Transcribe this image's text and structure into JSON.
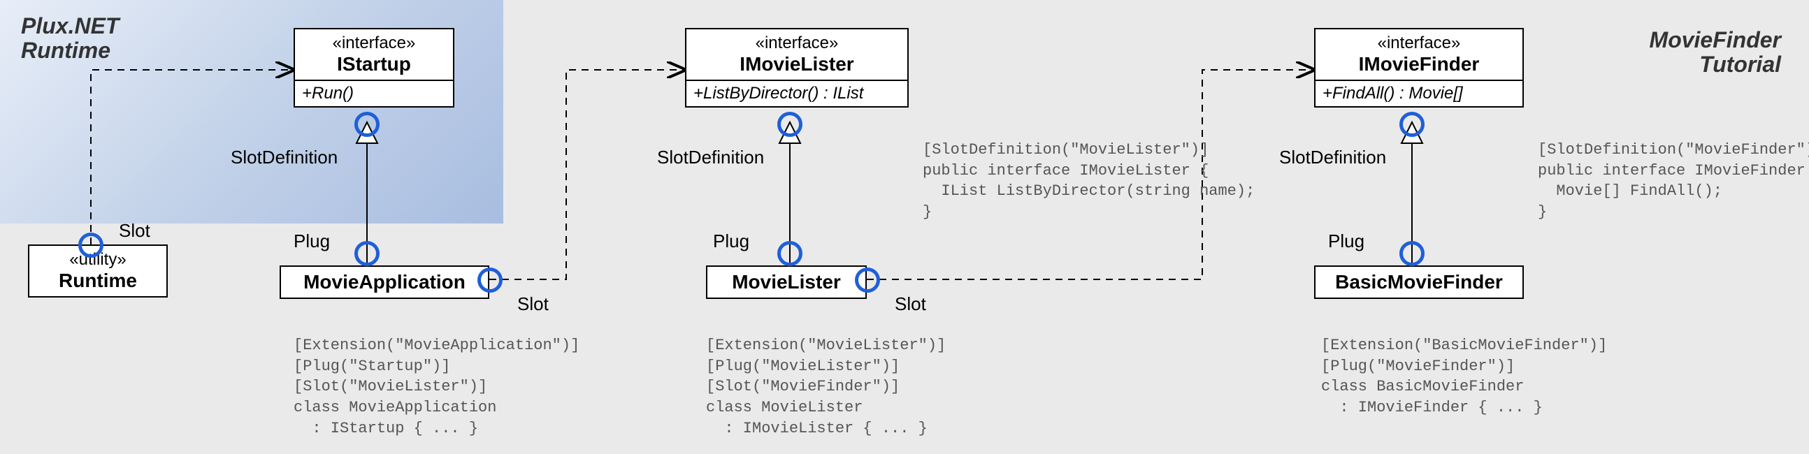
{
  "titles": {
    "left_line1": "Plux.NET",
    "left_line2": "Runtime",
    "right_line1": "MovieFinder",
    "right_line2": "Tutorial"
  },
  "boxes": {
    "runtime": {
      "stereo": "«utility»",
      "name": "Runtime"
    },
    "istartup": {
      "stereo": "«interface»",
      "name": "IStartup",
      "op": "+Run()"
    },
    "imovielister": {
      "stereo": "«interface»",
      "name": "IMovieLister",
      "op": "+ListByDirector() : IList"
    },
    "imoviefinder": {
      "stereo": "«interface»",
      "name": "IMovieFinder",
      "op": "+FindAll() : Movie[]"
    },
    "movieapplication": {
      "name": "MovieApplication"
    },
    "movielister": {
      "name": "MovieLister"
    },
    "basicmoviefinder": {
      "name": "BasicMovieFinder"
    }
  },
  "labels": {
    "slot": "Slot",
    "slotdef": "SlotDefinition",
    "plug": "Plug"
  },
  "code": {
    "imovielister": "[SlotDefinition(\"MovieLister\")]\npublic interface IMovieLister {\n  IList ListByDirector(string name);\n}",
    "imoviefinder": "[SlotDefinition(\"MovieFinder\")]\npublic interface IMovieFinder {\n  Movie[] FindAll();\n}",
    "movieapplication": "[Extension(\"MovieApplication\")]\n[Plug(\"Startup\")]\n[Slot(\"MovieLister\")]\nclass MovieApplication\n  : IStartup { ... }",
    "movielister": "[Extension(\"MovieLister\")]\n[Plug(\"MovieLister\")]\n[Slot(\"MovieFinder\")]\nclass MovieLister\n  : IMovieLister { ... }",
    "basicmoviefinder": "[Extension(\"BasicMovieFinder\")]\n[Plug(\"MovieFinder\")]\nclass BasicMovieFinder\n  : IMovieFinder { ... }"
  },
  "chart_data": {
    "type": "diagram",
    "notation": "UML-like Plux.NET component diagram",
    "components": [
      {
        "name": "Runtime",
        "stereotype": "utility",
        "slots": [
          "IStartup"
        ]
      },
      {
        "name": "IStartup",
        "stereotype": "interface",
        "operations": [
          "+Run()"
        ]
      },
      {
        "name": "MovieApplication",
        "plugs": [
          "Startup"
        ],
        "slots": [
          "MovieLister"
        ],
        "implements": [
          "IStartup"
        ]
      },
      {
        "name": "IMovieLister",
        "stereotype": "interface",
        "operations": [
          "+ListByDirector() : IList"
        ]
      },
      {
        "name": "MovieLister",
        "plugs": [
          "MovieLister"
        ],
        "slots": [
          "MovieFinder"
        ],
        "implements": [
          "IMovieLister"
        ]
      },
      {
        "name": "IMovieFinder",
        "stereotype": "interface",
        "operations": [
          "+FindAll() : Movie[]"
        ]
      },
      {
        "name": "BasicMovieFinder",
        "plugs": [
          "MovieFinder"
        ],
        "implements": [
          "IMovieFinder"
        ]
      }
    ],
    "connections": [
      {
        "from": "Runtime",
        "to": "IStartup",
        "kind": "slot-dependency"
      },
      {
        "from": "MovieApplication",
        "to": "IStartup",
        "kind": "realization/plug"
      },
      {
        "from": "MovieApplication",
        "to": "IMovieLister",
        "kind": "slot-dependency"
      },
      {
        "from": "MovieLister",
        "to": "IMovieLister",
        "kind": "realization/plug"
      },
      {
        "from": "MovieLister",
        "to": "IMovieFinder",
        "kind": "slot-dependency"
      },
      {
        "from": "BasicMovieFinder",
        "to": "IMovieFinder",
        "kind": "realization/plug"
      }
    ]
  }
}
